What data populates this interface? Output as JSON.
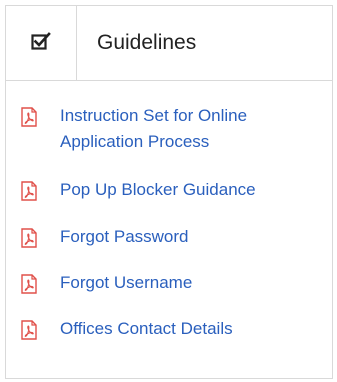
{
  "panel": {
    "title": "Guidelines",
    "header_icon": "checkbox-checked-icon"
  },
  "links": [
    {
      "icon": "pdf-file-icon",
      "label_line1": "Instruction Set for Online",
      "label_line2": "Application Process"
    },
    {
      "icon": "pdf-file-icon",
      "label_line1": "Pop Up Blocker Guidance",
      "label_line2": ""
    },
    {
      "icon": "pdf-file-icon",
      "label_line1": "Forgot Password",
      "label_line2": ""
    },
    {
      "icon": "pdf-file-icon",
      "label_line1": "Forgot Username",
      "label_line2": ""
    },
    {
      "icon": "pdf-file-icon",
      "label_line1": "Offices Contact Details",
      "label_line2": ""
    }
  ],
  "colors": {
    "link": "#2a5fbd",
    "pdf_icon": "#e0504a",
    "border": "#d9d9d9"
  }
}
